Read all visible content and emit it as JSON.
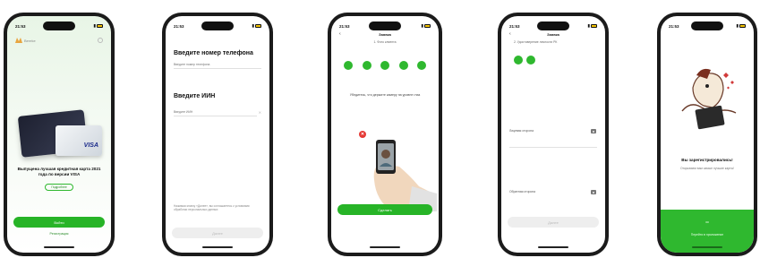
{
  "status": {
    "time": "21:53"
  },
  "screen1": {
    "brand": "Bereke",
    "headline": "Выпущена лучшая кредитная карта 2021 года по версии VISA",
    "card_brand": "VISA",
    "detail_label": "Подробнее",
    "primary_label": "Войти",
    "secondary_label": "Регистрация"
  },
  "screen2": {
    "phone_title": "Введите номер телефона",
    "phone_placeholder": "Введите номер телефона",
    "iin_title": "Введите ИИН",
    "iin_placeholder": "Введите ИИН",
    "consent_text": "Нажимая кнопку «Далее», вы соглашаетесь с условиями обработки персональных данных",
    "next_label": "Далее"
  },
  "screen3": {
    "nav_title": "Заявка",
    "step_label": "1. Фото клиента",
    "steps_done": 5,
    "instruction": "Убедитесь, что держите камеру на уровне глаз",
    "action_label": "Сделать"
  },
  "screen4": {
    "nav_title": "Заявка",
    "step_label": "2. Удостоверение личности РК",
    "steps_done": 2,
    "front_label": "Лицевая сторона",
    "back_label": "Обратная сторона",
    "continue_label": "Далее"
  },
  "screen5": {
    "title": "Вы зарегистрировались!",
    "subtitle": "Открываем вам самые лучшие карты!",
    "footer_title": "ок",
    "footer_label": "Перейти в приложение"
  }
}
